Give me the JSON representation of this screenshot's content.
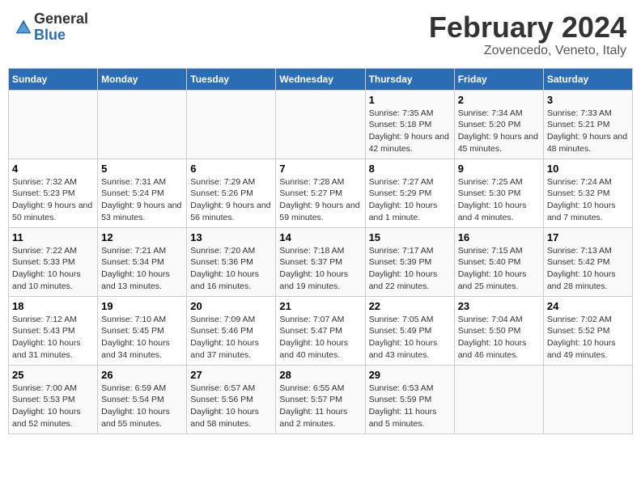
{
  "header": {
    "logo_general": "General",
    "logo_blue": "Blue",
    "title": "February 2024",
    "subtitle": "Zovencedo, Veneto, Italy"
  },
  "columns": [
    "Sunday",
    "Monday",
    "Tuesday",
    "Wednesday",
    "Thursday",
    "Friday",
    "Saturday"
  ],
  "weeks": [
    [
      {
        "day": "",
        "info": ""
      },
      {
        "day": "",
        "info": ""
      },
      {
        "day": "",
        "info": ""
      },
      {
        "day": "",
        "info": ""
      },
      {
        "day": "1",
        "info": "Sunrise: 7:35 AM\nSunset: 5:18 PM\nDaylight: 9 hours and 42 minutes."
      },
      {
        "day": "2",
        "info": "Sunrise: 7:34 AM\nSunset: 5:20 PM\nDaylight: 9 hours and 45 minutes."
      },
      {
        "day": "3",
        "info": "Sunrise: 7:33 AM\nSunset: 5:21 PM\nDaylight: 9 hours and 48 minutes."
      }
    ],
    [
      {
        "day": "4",
        "info": "Sunrise: 7:32 AM\nSunset: 5:23 PM\nDaylight: 9 hours and 50 minutes."
      },
      {
        "day": "5",
        "info": "Sunrise: 7:31 AM\nSunset: 5:24 PM\nDaylight: 9 hours and 53 minutes."
      },
      {
        "day": "6",
        "info": "Sunrise: 7:29 AM\nSunset: 5:26 PM\nDaylight: 9 hours and 56 minutes."
      },
      {
        "day": "7",
        "info": "Sunrise: 7:28 AM\nSunset: 5:27 PM\nDaylight: 9 hours and 59 minutes."
      },
      {
        "day": "8",
        "info": "Sunrise: 7:27 AM\nSunset: 5:29 PM\nDaylight: 10 hours and 1 minute."
      },
      {
        "day": "9",
        "info": "Sunrise: 7:25 AM\nSunset: 5:30 PM\nDaylight: 10 hours and 4 minutes."
      },
      {
        "day": "10",
        "info": "Sunrise: 7:24 AM\nSunset: 5:32 PM\nDaylight: 10 hours and 7 minutes."
      }
    ],
    [
      {
        "day": "11",
        "info": "Sunrise: 7:22 AM\nSunset: 5:33 PM\nDaylight: 10 hours and 10 minutes."
      },
      {
        "day": "12",
        "info": "Sunrise: 7:21 AM\nSunset: 5:34 PM\nDaylight: 10 hours and 13 minutes."
      },
      {
        "day": "13",
        "info": "Sunrise: 7:20 AM\nSunset: 5:36 PM\nDaylight: 10 hours and 16 minutes."
      },
      {
        "day": "14",
        "info": "Sunrise: 7:18 AM\nSunset: 5:37 PM\nDaylight: 10 hours and 19 minutes."
      },
      {
        "day": "15",
        "info": "Sunrise: 7:17 AM\nSunset: 5:39 PM\nDaylight: 10 hours and 22 minutes."
      },
      {
        "day": "16",
        "info": "Sunrise: 7:15 AM\nSunset: 5:40 PM\nDaylight: 10 hours and 25 minutes."
      },
      {
        "day": "17",
        "info": "Sunrise: 7:13 AM\nSunset: 5:42 PM\nDaylight: 10 hours and 28 minutes."
      }
    ],
    [
      {
        "day": "18",
        "info": "Sunrise: 7:12 AM\nSunset: 5:43 PM\nDaylight: 10 hours and 31 minutes."
      },
      {
        "day": "19",
        "info": "Sunrise: 7:10 AM\nSunset: 5:45 PM\nDaylight: 10 hours and 34 minutes."
      },
      {
        "day": "20",
        "info": "Sunrise: 7:09 AM\nSunset: 5:46 PM\nDaylight: 10 hours and 37 minutes."
      },
      {
        "day": "21",
        "info": "Sunrise: 7:07 AM\nSunset: 5:47 PM\nDaylight: 10 hours and 40 minutes."
      },
      {
        "day": "22",
        "info": "Sunrise: 7:05 AM\nSunset: 5:49 PM\nDaylight: 10 hours and 43 minutes."
      },
      {
        "day": "23",
        "info": "Sunrise: 7:04 AM\nSunset: 5:50 PM\nDaylight: 10 hours and 46 minutes."
      },
      {
        "day": "24",
        "info": "Sunrise: 7:02 AM\nSunset: 5:52 PM\nDaylight: 10 hours and 49 minutes."
      }
    ],
    [
      {
        "day": "25",
        "info": "Sunrise: 7:00 AM\nSunset: 5:53 PM\nDaylight: 10 hours and 52 minutes."
      },
      {
        "day": "26",
        "info": "Sunrise: 6:59 AM\nSunset: 5:54 PM\nDaylight: 10 hours and 55 minutes."
      },
      {
        "day": "27",
        "info": "Sunrise: 6:57 AM\nSunset: 5:56 PM\nDaylight: 10 hours and 58 minutes."
      },
      {
        "day": "28",
        "info": "Sunrise: 6:55 AM\nSunset: 5:57 PM\nDaylight: 11 hours and 2 minutes."
      },
      {
        "day": "29",
        "info": "Sunrise: 6:53 AM\nSunset: 5:59 PM\nDaylight: 11 hours and 5 minutes."
      },
      {
        "day": "",
        "info": ""
      },
      {
        "day": "",
        "info": ""
      }
    ]
  ]
}
